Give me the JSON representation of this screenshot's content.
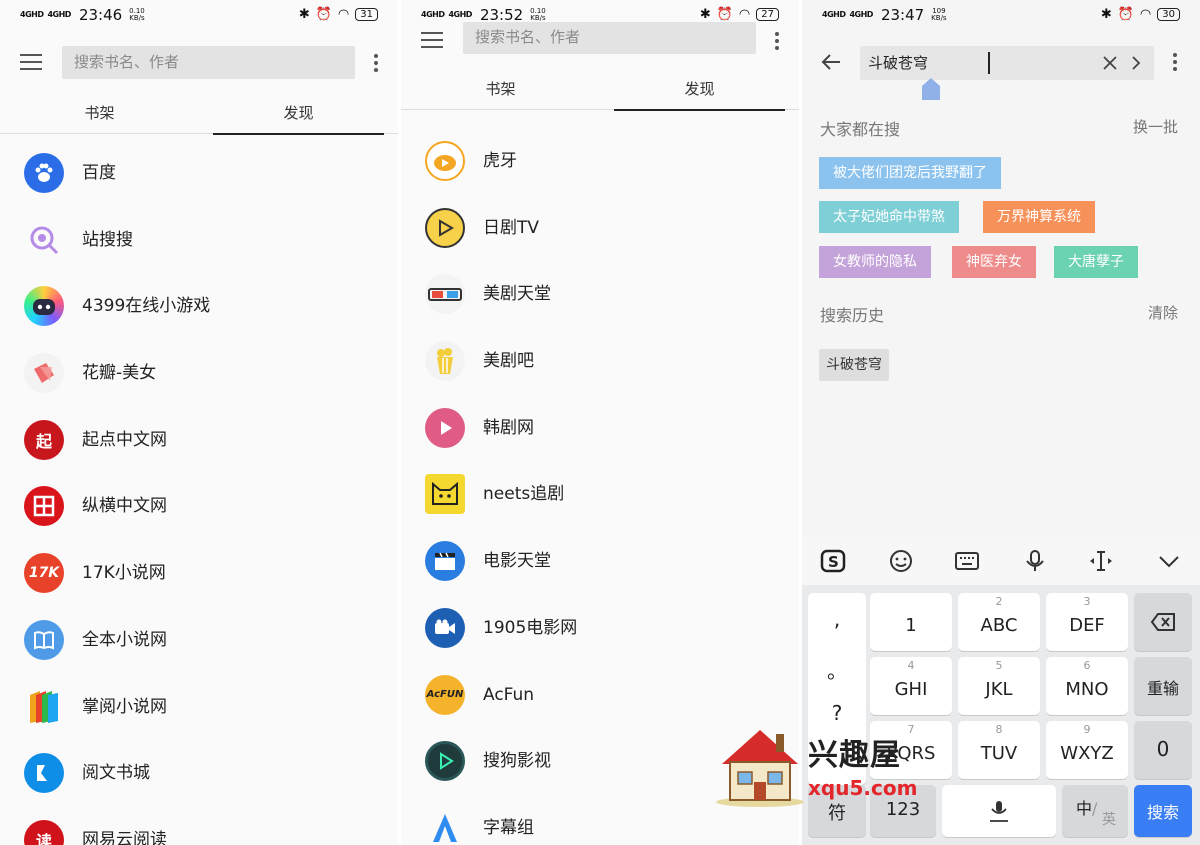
{
  "panel1": {
    "status": {
      "signal1": "4GHD",
      "signal2": "4GHD",
      "time": "23:46",
      "speed_value": "0.10",
      "speed_unit": "KB/s",
      "battery": "31"
    },
    "search_placeholder": "搜索书名、作者",
    "tabs": [
      "书架",
      "发现"
    ],
    "active_tab": "发现",
    "items": [
      {
        "label": "百度",
        "icon": "baidu-paw-icon",
        "color": "#2b6de6"
      },
      {
        "label": "站搜搜",
        "icon": "magnifier-icon",
        "color": "#b58be8"
      },
      {
        "label": "4399在线小游戏",
        "icon": "robot-icon",
        "color": "#1fa6f0"
      },
      {
        "label": "花瓣-美女",
        "icon": "petal-icon",
        "color": "#ef6b6b"
      },
      {
        "label": "起点中文网",
        "icon": "qidian-seal-icon",
        "color": "#c8161d"
      },
      {
        "label": "纵横中文网",
        "icon": "zongheng-icon",
        "color": "#d9141b"
      },
      {
        "label": "17K小说网",
        "icon": "17k-icon",
        "color": "#e8422a"
      },
      {
        "label": "全本小说网",
        "icon": "book-icon",
        "color": "#4f9be8"
      },
      {
        "label": "掌阅小说网",
        "icon": "ireader-icon",
        "color": "#f0a21b"
      },
      {
        "label": "阅文书城",
        "icon": "yuewen-icon",
        "color": "#0f8ee8"
      },
      {
        "label": "网易云阅读",
        "icon": "netease-icon",
        "color": "#d0121a"
      }
    ]
  },
  "panel2": {
    "status": {
      "signal1": "4GHD",
      "signal2": "4GHD",
      "time": "23:52",
      "speed_value": "0.10",
      "speed_unit": "KB/s",
      "battery": "27"
    },
    "search_placeholder": "搜索书名、作者",
    "tabs": [
      "书架",
      "发现"
    ],
    "active_tab": "发现",
    "items": [
      {
        "label": "虎牙",
        "icon": "huya-icon",
        "color": "#f5a623"
      },
      {
        "label": "日剧TV",
        "icon": "play-circle-icon",
        "color": "#f7d14a"
      },
      {
        "label": "美剧天堂",
        "icon": "3d-glasses-icon",
        "color": "#eeeeee"
      },
      {
        "label": "美剧吧",
        "icon": "popcorn-icon",
        "color": "#f4cd3a"
      },
      {
        "label": "韩剧网",
        "icon": "play-pink-icon",
        "color": "#e05c85"
      },
      {
        "label": "neets追剧",
        "icon": "cat-face-icon",
        "color": "#f4d830"
      },
      {
        "label": "电影天堂",
        "icon": "clapperboard-icon",
        "color": "#2a7de0"
      },
      {
        "label": "1905电影网",
        "icon": "camera-icon",
        "color": "#1d5fb3"
      },
      {
        "label": "AcFun",
        "icon": "acfun-icon",
        "color": "#f5b32b"
      },
      {
        "label": "搜狗影视",
        "icon": "sogou-play-icon",
        "color": "#1f3b3c"
      },
      {
        "label": "字幕组",
        "icon": "subtitle-a-icon",
        "color": "#2f8cf0"
      }
    ]
  },
  "panel3": {
    "status": {
      "signal1": "4GHD",
      "signal2": "4GHD",
      "time": "23:47",
      "speed_value": "109",
      "speed_unit": "KB/s",
      "battery": "30"
    },
    "search_value": "斗破苍穹",
    "popular_title": "大家都在搜",
    "popular_action": "换一批",
    "popular_chips": [
      {
        "label": "被大佬们团宠后我野翻了",
        "color": "#8cc3ee"
      },
      {
        "label": "太子妃她命中带煞",
        "color": "#7fcfd6"
      },
      {
        "label": "万界神算系统",
        "color": "#f6915a"
      },
      {
        "label": "女教师的隐私",
        "color": "#c3a3d9"
      },
      {
        "label": "神医弃女",
        "color": "#ee8c8c"
      },
      {
        "label": "大唐孽子",
        "color": "#6cd2b4"
      }
    ],
    "history_title": "搜索历史",
    "history_action": "清除",
    "history_chips": [
      "斗破苍穹"
    ],
    "keyboard": {
      "punct": [
        ",",
        "。",
        "?"
      ],
      "keys": [
        {
          "num": "",
          "main": "1"
        },
        {
          "num": "2",
          "main": "ABC"
        },
        {
          "num": "3",
          "main": "DEF"
        },
        {
          "num": "4",
          "main": "GHI"
        },
        {
          "num": "5",
          "main": "JKL"
        },
        {
          "num": "6",
          "main": "MNO"
        },
        {
          "num": "7",
          "main": "PQRS"
        },
        {
          "num": "8",
          "main": "TUV"
        },
        {
          "num": "9",
          "main": "WXYZ"
        }
      ],
      "reinput": "重输",
      "zero": "0",
      "symbol": "符",
      "numbers": "123",
      "lang_zh": "中",
      "lang_en": "英",
      "search": "搜索"
    }
  },
  "watermark": {
    "text": "兴趣屋",
    "url": "xqu5.com"
  }
}
